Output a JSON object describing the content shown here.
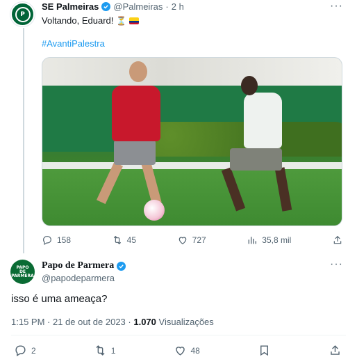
{
  "tweet1": {
    "author_name": "SE Palmeiras",
    "handle": "@Palmeiras",
    "separator": "·",
    "time": "2 h",
    "text": "Voltando, Eduard!",
    "hashtag": "#AvantiPalestra",
    "stats": {
      "replies": "158",
      "retweets": "45",
      "likes": "727",
      "views": "35,8 mil"
    }
  },
  "tweet2": {
    "author_name": "Papo de Parmera",
    "handle": "@papodeparmera",
    "avatar_text": [
      "PAPO",
      "DE",
      "PARMERA"
    ],
    "text": "isso é uma ameaça?",
    "timestamp": "1:15 PM · 21 de out de 2023 ·",
    "views_count": "1.070",
    "views_label": "Visualizações",
    "stats": {
      "replies": "2",
      "retweets": "1",
      "likes": "48"
    }
  },
  "icons": {
    "reply": "reply-icon",
    "retweet": "retweet-icon",
    "like": "heart-icon",
    "views": "bar-chart-icon",
    "share": "share-icon",
    "bookmark": "bookmark-icon",
    "more": "more-icon"
  },
  "colors": {
    "accent": "#1d9bf0",
    "muted": "#536471",
    "palmeiras_green": "#006437"
  }
}
